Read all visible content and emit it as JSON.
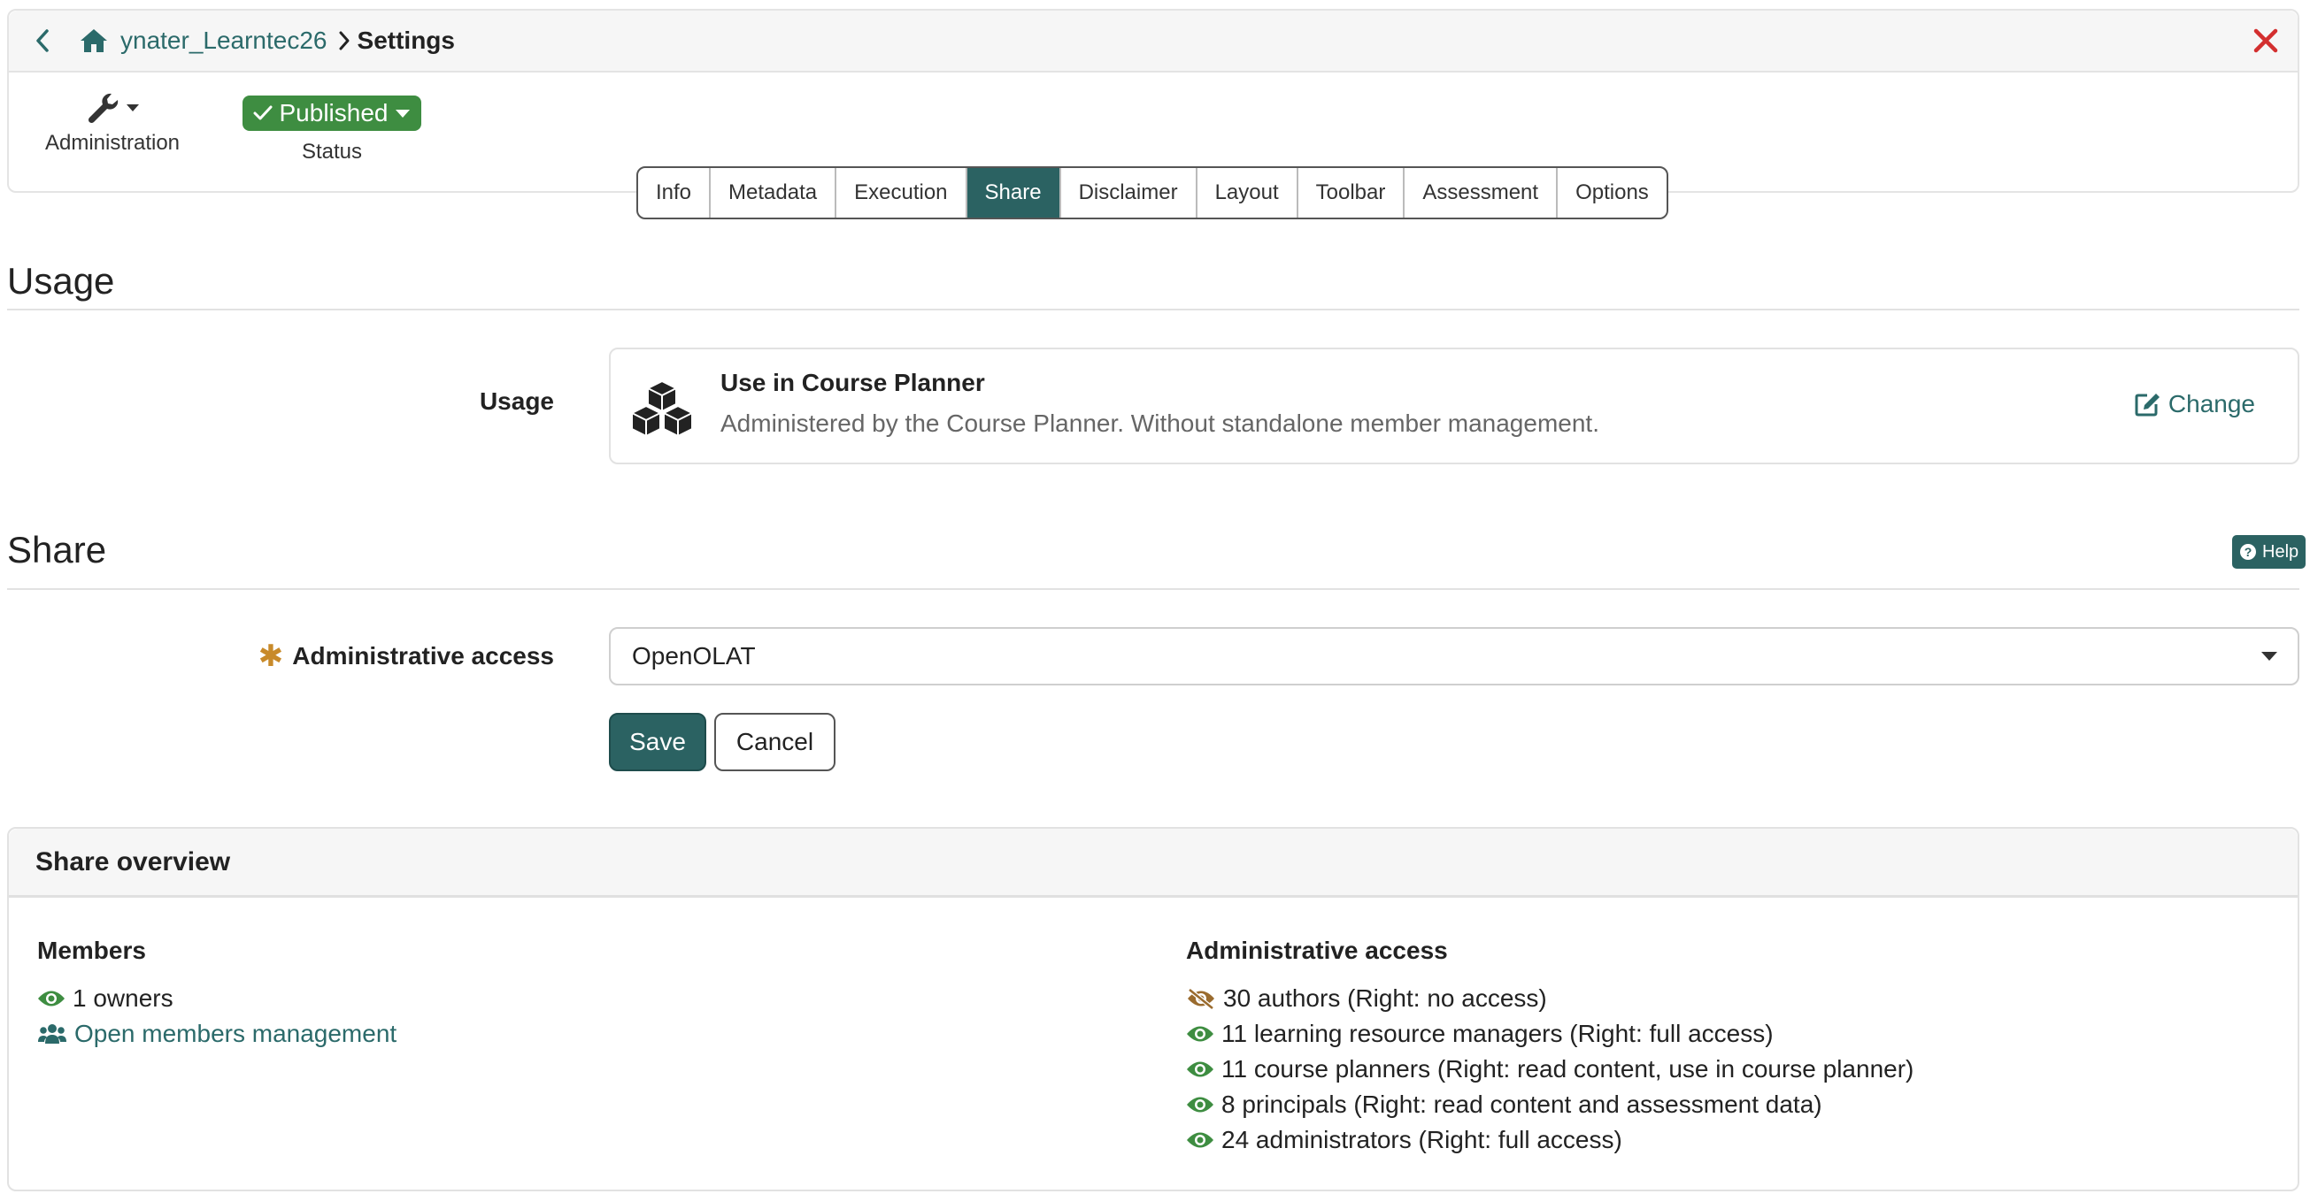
{
  "breadcrumb": {
    "parent": "ynater_Learntec26",
    "current": "Settings"
  },
  "toolbar": {
    "administration_label": "Administration",
    "status_value": "Published",
    "status_label": "Status"
  },
  "tabs": [
    {
      "label": "Info",
      "active": false
    },
    {
      "label": "Metadata",
      "active": false
    },
    {
      "label": "Execution",
      "active": false
    },
    {
      "label": "Share",
      "active": true
    },
    {
      "label": "Disclaimer",
      "active": false
    },
    {
      "label": "Layout",
      "active": false
    },
    {
      "label": "Toolbar",
      "active": false
    },
    {
      "label": "Assessment",
      "active": false
    },
    {
      "label": "Options",
      "active": false
    }
  ],
  "usage_section": {
    "heading": "Usage",
    "field_label": "Usage",
    "card_title": "Use in Course Planner",
    "card_description": "Administered by the Course Planner. Without standalone member management.",
    "change_label": "Change"
  },
  "share_section": {
    "heading": "Share",
    "help_label": "Help",
    "admin_access_label": "Administrative access",
    "admin_access_value": "OpenOLAT",
    "save_label": "Save",
    "cancel_label": "Cancel"
  },
  "overview": {
    "title": "Share overview",
    "members_heading": "Members",
    "owners_text": "1 owners",
    "members_link": "Open members management",
    "admin_heading": "Administrative access",
    "admin_rows": [
      {
        "text": "30 authors (Right: no access)",
        "icon": "eye-slash-icon"
      },
      {
        "text": "11 learning resource managers (Right: full access)",
        "icon": "eye-icon"
      },
      {
        "text": "11 course planners (Right: read content, use in course planner)",
        "icon": "eye-icon"
      },
      {
        "text": "8 principals (Right: read content and assessment data)",
        "icon": "eye-icon"
      },
      {
        "text": "24 administrators (Right: full access)",
        "icon": "eye-icon"
      }
    ]
  },
  "colors": {
    "accent": "#2b6262",
    "link": "#2b6a6a",
    "published": "#3e8d41",
    "close": "#d32f2f",
    "visible_icon": "#3e8d41",
    "hidden_icon": "#9a6b2e"
  }
}
